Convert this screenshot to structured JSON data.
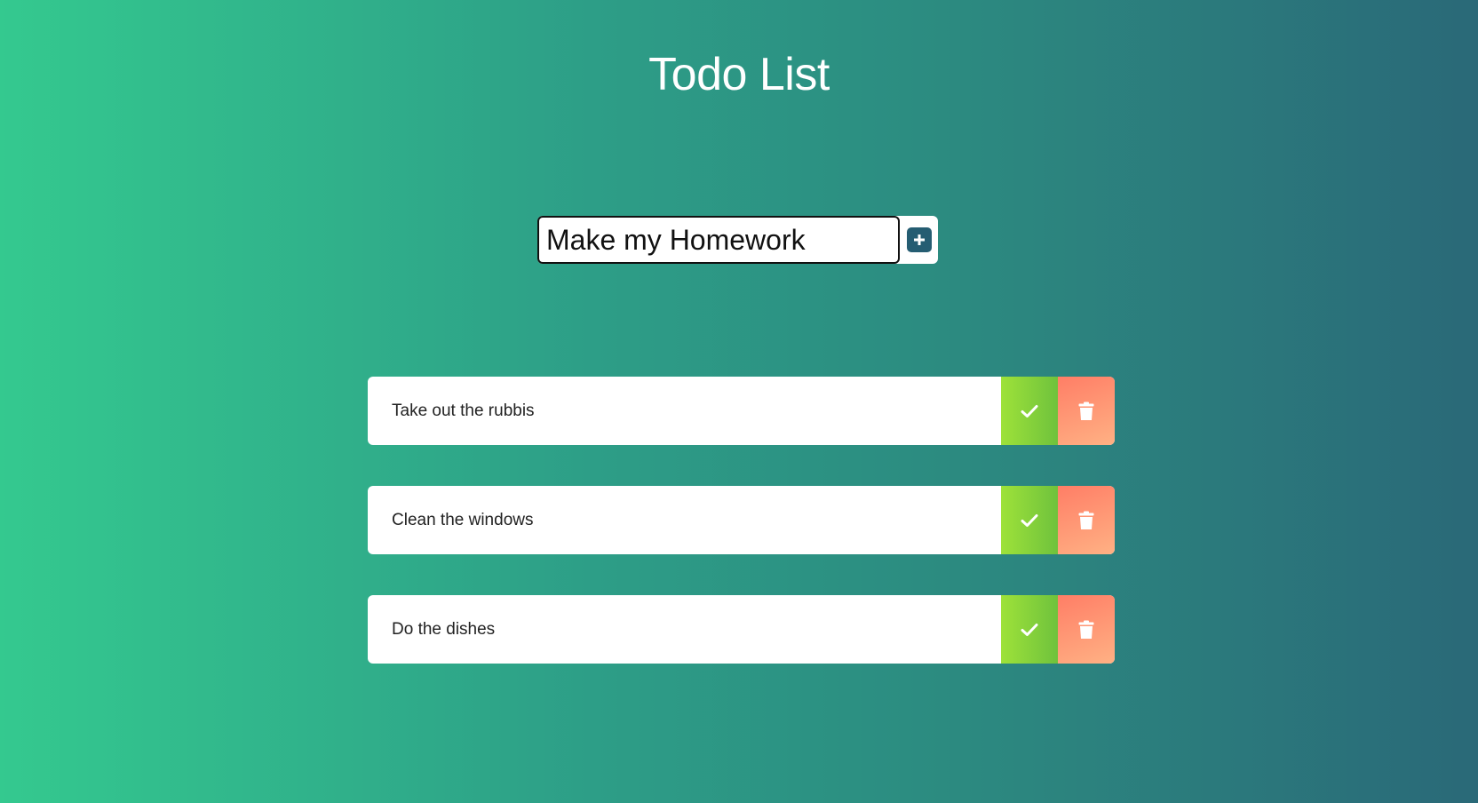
{
  "app": {
    "title": "Todo List"
  },
  "form": {
    "input_value": "Make my Homework",
    "add_icon": "plus-square-icon"
  },
  "todos": [
    {
      "text": "Take out the rubbis",
      "complete_icon": "check-icon",
      "delete_icon": "trash-icon"
    },
    {
      "text": "Clean the windows",
      "complete_icon": "check-icon",
      "delete_icon": "trash-icon"
    },
    {
      "text": "Do the dishes",
      "complete_icon": "check-icon",
      "delete_icon": "trash-icon"
    }
  ],
  "colors": {
    "background_start": "#34c98f",
    "background_end": "#2a6978",
    "add_button": "#255d72",
    "complete_start": "#9ee23a",
    "complete_end": "#6fc23c",
    "delete_start": "#ff7e66",
    "delete_end": "#ffb184"
  }
}
